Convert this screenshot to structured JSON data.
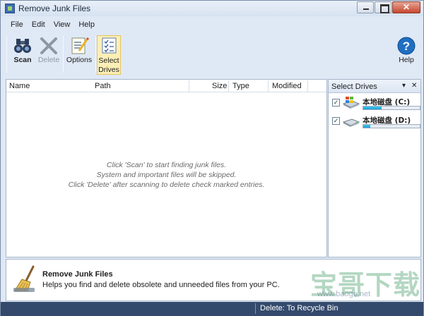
{
  "window": {
    "title": "Remove Junk Files"
  },
  "menu": {
    "items": [
      "File",
      "Edit",
      "View",
      "Help"
    ]
  },
  "toolbar": {
    "scan": "Scan",
    "delete": "Delete",
    "options": "Options",
    "select_drives_line1": "Select",
    "select_drives_line2": "Drives",
    "help": "Help"
  },
  "list": {
    "columns": [
      "Name",
      "Path",
      "Size",
      "Type",
      "Modified"
    ],
    "hints": [
      "Click 'Scan' to start finding junk files.",
      "System and important files will be skipped.",
      "Click 'Delete' after scanning to delete check marked entries."
    ]
  },
  "drives": {
    "title": "Select Drives",
    "items": [
      {
        "name": "本地磁盘 (C:)",
        "checked": true,
        "usage": 0.32,
        "icon": "windows-drive-icon"
      },
      {
        "name": "本地磁盘 (D:)",
        "checked": true,
        "usage": 0.12,
        "icon": "hard-drive-icon"
      }
    ]
  },
  "description": {
    "title": "Remove Junk Files",
    "text": "Helps you find and delete obsolete and unneeded files from your PC."
  },
  "status": {
    "text": "Delete: To Recycle Bin"
  },
  "watermark": {
    "text": "宝哥下载",
    "sub": "www.baoge.net"
  },
  "colors": {
    "accent": "#344a6c",
    "usage_bar": "#1a9fd6",
    "active_tool": "#fcefb6"
  }
}
